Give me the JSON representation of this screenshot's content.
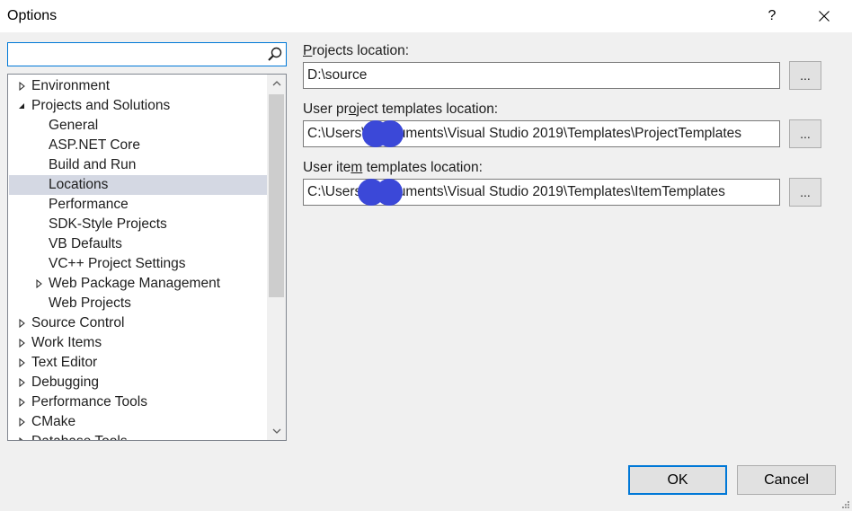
{
  "window": {
    "title": "Options",
    "help_label": "?"
  },
  "search": {
    "value": "",
    "placeholder": ""
  },
  "tree": {
    "items": [
      {
        "label": "Environment",
        "expander": "collapsed",
        "level": 0
      },
      {
        "label": "Projects and Solutions",
        "expander": "expanded",
        "level": 0
      },
      {
        "label": "General",
        "expander": "none",
        "level": 1
      },
      {
        "label": "ASP.NET Core",
        "expander": "none",
        "level": 1
      },
      {
        "label": "Build and Run",
        "expander": "none",
        "level": 1
      },
      {
        "label": "Locations",
        "expander": "none",
        "level": 1,
        "selected": true
      },
      {
        "label": "Performance",
        "expander": "none",
        "level": 1
      },
      {
        "label": "SDK-Style Projects",
        "expander": "none",
        "level": 1
      },
      {
        "label": "VB Defaults",
        "expander": "none",
        "level": 1
      },
      {
        "label": "VC++ Project Settings",
        "expander": "none",
        "level": 1
      },
      {
        "label": "Web Package Management",
        "expander": "collapsed",
        "level": 1
      },
      {
        "label": "Web Projects",
        "expander": "none",
        "level": 1
      },
      {
        "label": "Source Control",
        "expander": "collapsed",
        "level": 0
      },
      {
        "label": "Work Items",
        "expander": "collapsed",
        "level": 0
      },
      {
        "label": "Text Editor",
        "expander": "collapsed",
        "level": 0
      },
      {
        "label": "Debugging",
        "expander": "collapsed",
        "level": 0
      },
      {
        "label": "Performance Tools",
        "expander": "collapsed",
        "level": 0
      },
      {
        "label": "CMake",
        "expander": "collapsed",
        "level": 0
      },
      {
        "label": "Database Tools",
        "expander": "collapsed",
        "level": 0
      }
    ]
  },
  "fields": [
    {
      "label_pre": "",
      "label_key": "P",
      "label_post": "rojects location:",
      "value": "D:\\source",
      "browse_label": "..."
    },
    {
      "label_pre": "User pr",
      "label_key": "o",
      "label_post": "ject templates location:",
      "value": "C:\\Users\\        \\Documents\\Visual Studio 2019\\Templates\\ProjectTemplates",
      "browse_label": "..."
    },
    {
      "label_pre": "User ite",
      "label_key": "m",
      "label_post": " templates location:",
      "value": "C:\\Users\\        \\Documents\\Visual Studio 2019\\Templates\\ItemTemplates",
      "browse_label": "..."
    }
  ],
  "buttons": {
    "ok": "OK",
    "cancel": "Cancel"
  },
  "colors": {
    "accent": "#0078d7",
    "selection": "#d4d8e3",
    "redaction": "#3b48d8"
  }
}
